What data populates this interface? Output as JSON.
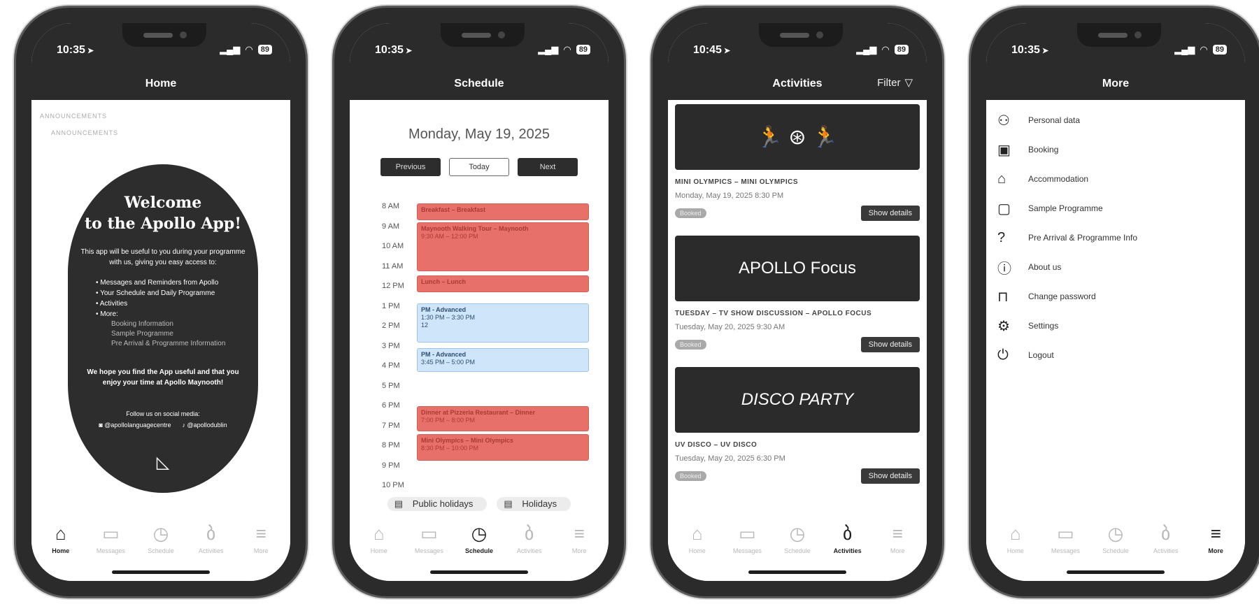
{
  "status": {
    "battery": "89",
    "signal": "•ıl",
    "wifi": "⌔"
  },
  "tabs": [
    {
      "key": "home",
      "label": "Home",
      "icon": "home-icon"
    },
    {
      "key": "messages",
      "label": "Messages",
      "icon": "chat-icon"
    },
    {
      "key": "schedule",
      "label": "Schedule",
      "icon": "clock-icon"
    },
    {
      "key": "activities",
      "label": "Activities",
      "icon": "bike-icon"
    },
    {
      "key": "more",
      "label": "More",
      "icon": "menu-icon"
    }
  ],
  "home": {
    "time": "10:35",
    "title": "Home",
    "announcements": [
      "ANNOUNCEMENTS",
      "ANNOUNCEMENTS"
    ],
    "welcome_line1": "Welcome",
    "welcome_line2": "to the Apollo App!",
    "intro": "This app will be useful to you during your programme with us, giving you easy access to:",
    "bullets": [
      "Messages and Reminders from Apollo",
      "Your Schedule and Daily Programme",
      "Activities",
      "More:"
    ],
    "sub_items": [
      "Booking Information",
      "Sample Programme",
      "Pre Arrival & Programme Information"
    ],
    "hope": "We hope you find the App useful and that you enjoy your time at Apollo Maynooth!",
    "follow": "Follow us on social media:",
    "social_instagram": "@apollolanguagecentre",
    "social_tiktok": "@apollodublin"
  },
  "schedule": {
    "time": "10:35",
    "title": "Schedule",
    "date": "Monday, May 19, 2025",
    "btn_previous": "Previous",
    "btn_today": "Today",
    "btn_next": "Next",
    "hours": [
      "8 AM",
      "9 AM",
      "10 AM",
      "11 AM",
      "12 PM",
      "1 PM",
      "2 PM",
      "3 PM",
      "4 PM",
      "5 PM",
      "6 PM",
      "7 PM",
      "8 PM",
      "9 PM",
      "10 PM"
    ],
    "events": {
      "breakfast": "Breakfast – Breakfast",
      "tour_title": "Maynooth Walking Tour – Maynooth",
      "tour_time": "9:30 AM – 12:00 PM",
      "lunch": "Lunch – Lunch",
      "pm1_title": "PM - Advanced",
      "pm1_time": "1:30 PM – 3:30 PM",
      "pm1_room": "12",
      "pm2_title": "PM - Advanced",
      "pm2_time": "3:45 PM – 5:00 PM",
      "dinner_title": "Dinner at Pizzeria Restaurant – Dinner",
      "dinner_time": "7:00 PM – 8:00 PM",
      "olympics_title": "Mini Olympics – Mini Olympics",
      "olympics_time": "8:30 PM – 10:00 PM"
    },
    "legend_public": "Public holidays",
    "legend_holidays": "Holidays"
  },
  "activities": {
    "time": "10:45",
    "title": "Activities",
    "filter_label": "Filter",
    "items": [
      {
        "name": "MINI OLYMPICS – MINI OLYMPICS",
        "date": "Monday, May 19, 2025 8:30 PM",
        "status": "Booked",
        "button": "Show details",
        "banner": "🏃 ⊛ 🏃"
      },
      {
        "name": "TUESDAY – TV SHOW DISCUSSION – APOLLO FOCUS",
        "date": "Tuesday, May 20, 2025 9:30 AM",
        "status": "Booked",
        "button": "Show details",
        "banner": "APOLLO Focus"
      },
      {
        "name": "UV DISCO – UV DISCO",
        "date": "Tuesday, May 20, 2025 6:30 PM",
        "status": "Booked",
        "button": "Show details",
        "banner": "DISCO PARTY"
      }
    ]
  },
  "more": {
    "time": "10:35",
    "title": "More",
    "items": [
      {
        "label": "Personal data",
        "icon": "person-icon",
        "glyph": "⚇"
      },
      {
        "label": "Booking",
        "icon": "calendar-icon",
        "glyph": "▣"
      },
      {
        "label": "Accommodation",
        "icon": "house-icon",
        "glyph": "⌂"
      },
      {
        "label": "Sample Programme",
        "icon": "document-icon",
        "glyph": "▢"
      },
      {
        "label": "Pre Arrival & Programme Info",
        "icon": "question-icon",
        "glyph": "?"
      },
      {
        "label": "About us",
        "icon": "info-icon",
        "glyph": "ⓘ"
      },
      {
        "label": "Change password",
        "icon": "lock-icon",
        "glyph": "⊓"
      },
      {
        "label": "Settings",
        "icon": "gear-icon",
        "glyph": "⚙"
      },
      {
        "label": "Logout",
        "icon": "power-icon",
        "glyph": "⏻"
      }
    ]
  }
}
